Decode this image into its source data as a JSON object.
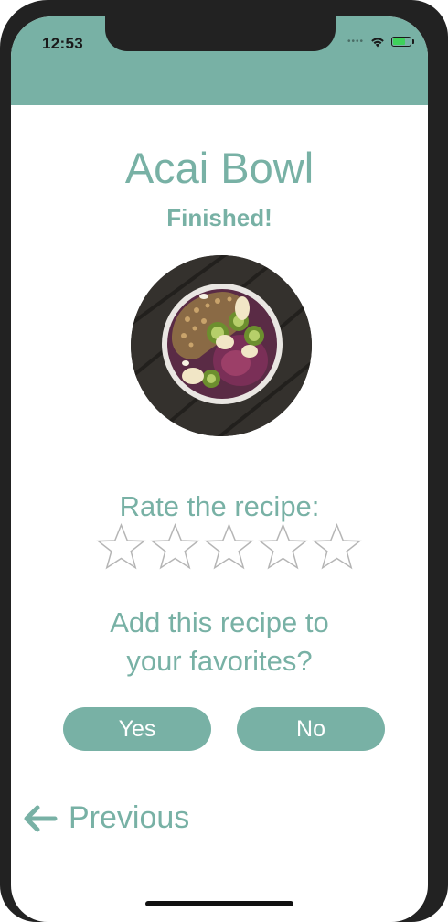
{
  "status_bar": {
    "time": "12:53"
  },
  "recipe": {
    "title": "Acai Bowl",
    "status": "Finished!",
    "image_icon": "acai-bowl-photo"
  },
  "rating": {
    "label": "Rate the recipe:",
    "max_stars": 5,
    "selected": 0
  },
  "favorites": {
    "question_line1": "Add this recipe to",
    "question_line2": "your favorites?",
    "yes_label": "Yes",
    "no_label": "No"
  },
  "navigation": {
    "previous_label": "Previous",
    "previous_icon": "arrow-left-icon"
  },
  "colors": {
    "accent": "#78b1a5",
    "star_outline": "#b5b5b5"
  }
}
